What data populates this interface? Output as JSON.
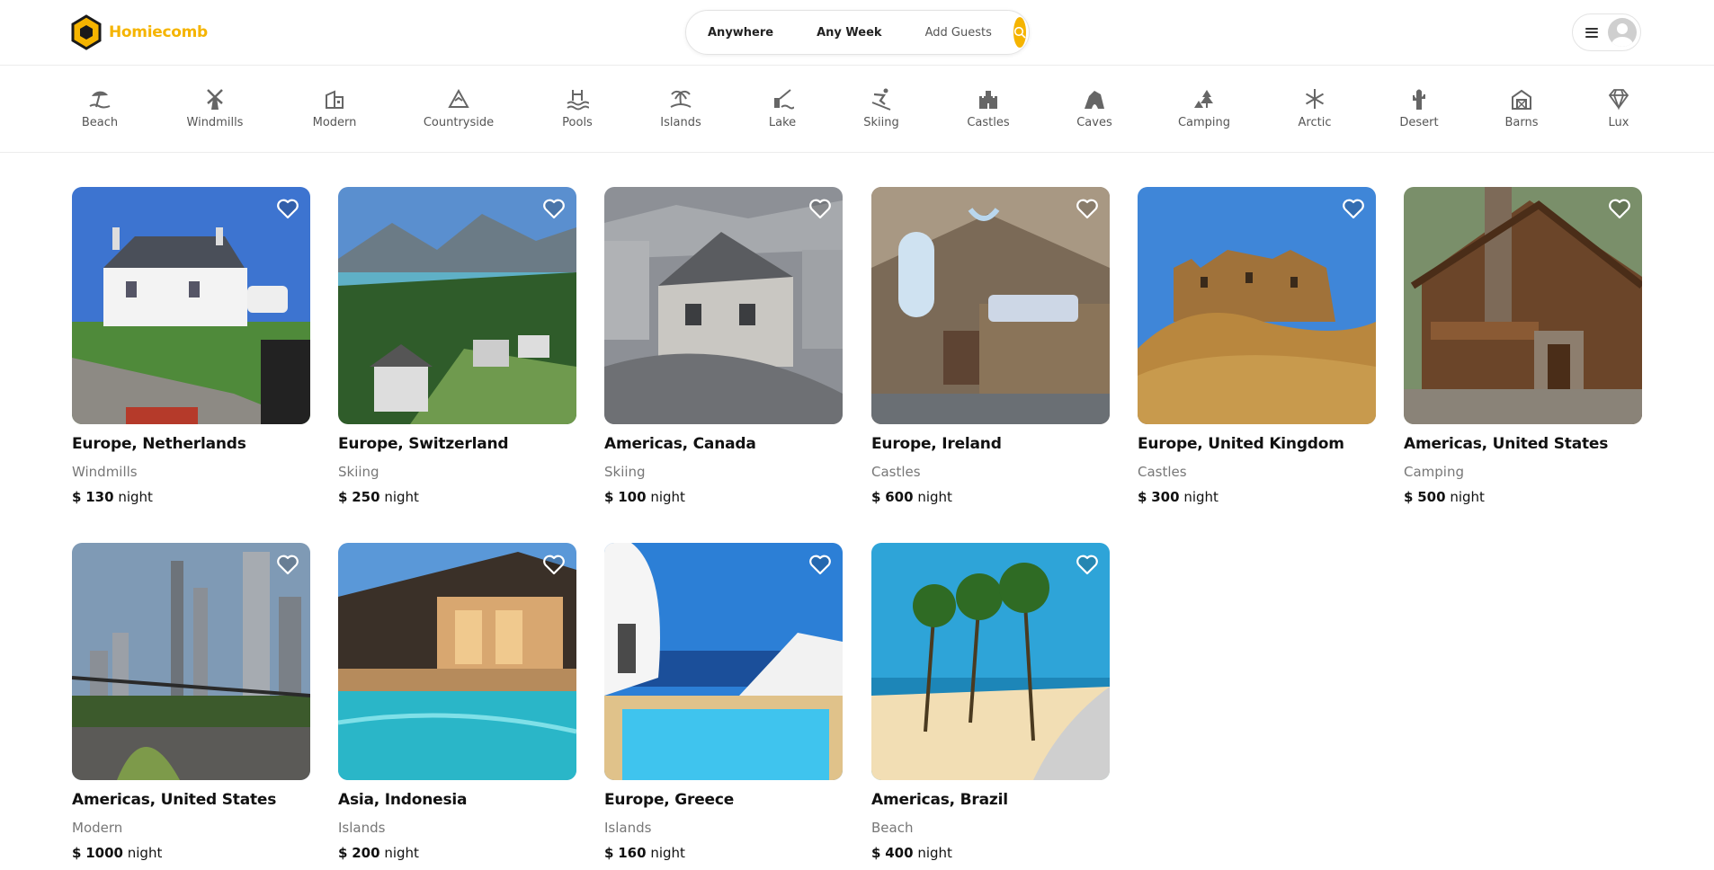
{
  "app": {
    "name": "Homiecomb"
  },
  "colors": {
    "accent": "#f5b400",
    "text": "#222222",
    "muted": "#777777",
    "border": "#ececec"
  },
  "search": {
    "where": "Anywhere",
    "when": "Any Week",
    "guests": "Add Guests",
    "icon": "search-icon"
  },
  "user_menu": {
    "menu_icon": "hamburger-icon",
    "avatar": "user-placeholder-avatar"
  },
  "categories": [
    {
      "label": "Beach",
      "icon": "beach-icon"
    },
    {
      "label": "Windmills",
      "icon": "windmill-icon"
    },
    {
      "label": "Modern",
      "icon": "modern-house-icon"
    },
    {
      "label": "Countryside",
      "icon": "mountain-icon"
    },
    {
      "label": "Pools",
      "icon": "pool-icon"
    },
    {
      "label": "Islands",
      "icon": "island-icon"
    },
    {
      "label": "Lake",
      "icon": "lake-icon"
    },
    {
      "label": "Skiing",
      "icon": "skiing-icon"
    },
    {
      "label": "Castles",
      "icon": "castle-icon"
    },
    {
      "label": "Caves",
      "icon": "cave-icon"
    },
    {
      "label": "Camping",
      "icon": "camping-icon"
    },
    {
      "label": "Arctic",
      "icon": "snowflake-icon"
    },
    {
      "label": "Desert",
      "icon": "cactus-icon"
    },
    {
      "label": "Barns",
      "icon": "barn-icon"
    },
    {
      "label": "Lux",
      "icon": "diamond-icon"
    }
  ],
  "price_unit": "night",
  "currency": "$",
  "listings": [
    {
      "location": "Europe, Netherlands",
      "category": "Windmills",
      "price": "130"
    },
    {
      "location": "Europe, Switzerland",
      "category": "Skiing",
      "price": "250"
    },
    {
      "location": "Americas, Canada",
      "category": "Skiing",
      "price": "100"
    },
    {
      "location": "Europe, Ireland",
      "category": "Castles",
      "price": "600"
    },
    {
      "location": "Europe, United Kingdom",
      "category": "Castles",
      "price": "300"
    },
    {
      "location": "Americas, United States",
      "category": "Camping",
      "price": "500"
    },
    {
      "location": "Americas, United States",
      "category": "Modern",
      "price": "1000"
    },
    {
      "location": "Asia, Indonesia",
      "category": "Islands",
      "price": "200"
    },
    {
      "location": "Europe, Greece",
      "category": "Islands",
      "price": "160"
    },
    {
      "location": "Americas, Brazil",
      "category": "Beach",
      "price": "400"
    }
  ]
}
